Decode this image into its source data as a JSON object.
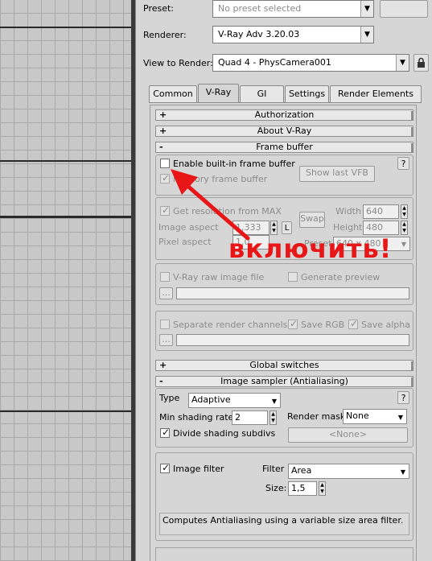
{
  "header": {
    "preset_label": "Preset:",
    "preset_value": "No preset selected",
    "renderer_label": "Renderer:",
    "renderer_value": "V-Ray Adv 3.20.03",
    "view_label": "View to Render:",
    "view_value": "Quad 4 - PhysCamera001"
  },
  "tabs": [
    {
      "label": "Common"
    },
    {
      "label": "V-Ray"
    },
    {
      "label": "GI"
    },
    {
      "label": "Settings"
    },
    {
      "label": "Render Elements"
    }
  ],
  "rollouts": {
    "authorization": {
      "sign": "+",
      "title": "Authorization"
    },
    "about": {
      "sign": "+",
      "title": "About V-Ray"
    },
    "frame_buffer": {
      "sign": "-",
      "title": "Frame buffer"
    },
    "global_switches": {
      "sign": "+",
      "title": "Global switches"
    },
    "image_sampler": {
      "sign": "-",
      "title": "Image sampler (Antialiasing)"
    }
  },
  "frame_buffer": {
    "enable_builtin": "Enable built-in frame buffer",
    "memory_fb": "Memory frame buffer",
    "show_last_vfb": "Show last VFB",
    "help": "?",
    "get_resolution": "Get resolution from MAX",
    "image_aspect_label": "Image aspect",
    "image_aspect_value": "1,333",
    "lock_label": "L",
    "pixel_aspect_label": "Pixel aspect",
    "pixel_aspect_value": "1,0",
    "swap": "Swap",
    "width_label": "Width",
    "width_value": "640",
    "height_label": "Height",
    "height_value": "480",
    "preset_label": "Preset",
    "preset_value": "640 x 480",
    "raw_image": "V-Ray raw image file",
    "generate_preview": "Generate preview",
    "browse": "...",
    "separate_channels": "Separate render channels",
    "save_rgb": "Save RGB",
    "save_alpha": "Save alpha"
  },
  "image_sampler": {
    "type_label": "Type",
    "type_value": "Adaptive",
    "help": "?",
    "min_shading_label": "Min shading rate",
    "min_shading_value": "2",
    "render_mask_label": "Render mask",
    "render_mask_value": "None",
    "divide_subdivs": "Divide shading subdivs",
    "none_button": "<None>",
    "image_filter": "Image filter",
    "filter_label": "Filter",
    "filter_value": "Area",
    "size_label": "Size:",
    "size_value": "1,5",
    "description": "Computes Antialiasing using a variable size area filter."
  },
  "annotation": {
    "text": "включить!",
    "color": "#e81616"
  }
}
